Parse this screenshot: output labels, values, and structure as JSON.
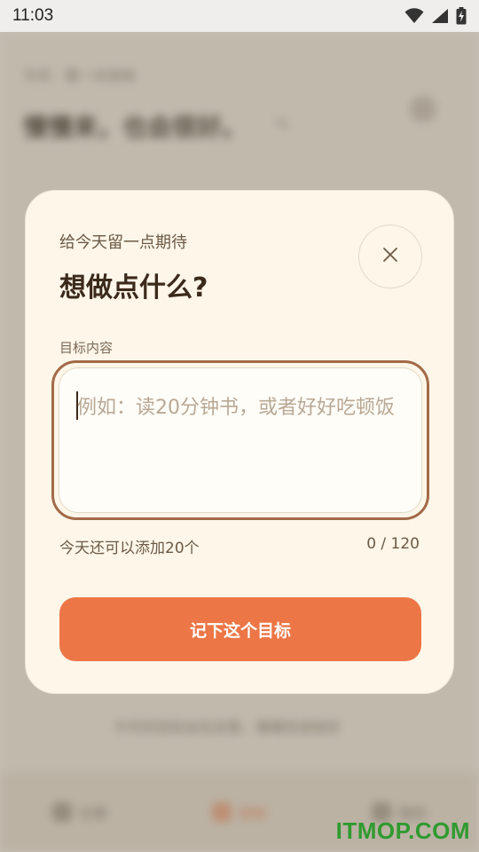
{
  "status_bar": {
    "time": "11:03",
    "icons": [
      "wifi-icon",
      "signal-icon",
      "battery-charging-icon"
    ]
  },
  "background": {
    "breadcrumb": "今天 · 第一次目标",
    "title": "慢慢来，也会很好。",
    "footer_text": "今天的目标会在这里，慢慢完成就好",
    "tabs": [
      {
        "label": "记录",
        "icon": "note-icon"
      },
      {
        "label": "目标",
        "icon": "target-icon"
      },
      {
        "label": "我的",
        "icon": "profile-icon"
      }
    ]
  },
  "modal": {
    "subtitle": "给今天留一点期待",
    "title": "想做点什么?",
    "close_icon": "close-icon",
    "field_label": "目标内容",
    "placeholder": "例如：读20分钟书，或者好好吃顿饭",
    "value": "",
    "remaining_hint": "今天还可以添加20个",
    "char_count": "0 / 120",
    "submit_label": "记下这个目标"
  },
  "colors": {
    "modal_bg": "#fdf6e9",
    "accent": "#ed7646",
    "focus_border": "#a36a47",
    "title_text": "#3b2a1b"
  },
  "watermark": "ITMOP.COM"
}
